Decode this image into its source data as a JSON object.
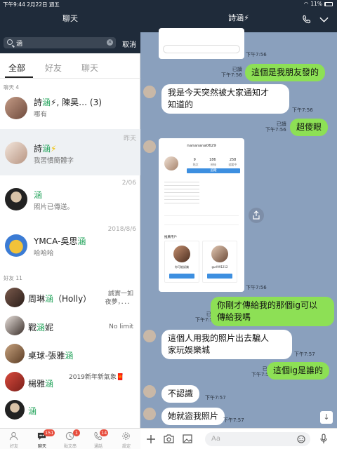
{
  "status": {
    "time_date": "下午9:44  2月22日 週五",
    "battery": "11%",
    "battery_level": 0.11
  },
  "left": {
    "title": "聊天",
    "search": {
      "value": "涵",
      "cancel": "取消"
    },
    "tabs": [
      "全部",
      "好友",
      "聊天"
    ],
    "section_chats": "聊天 4",
    "section_friends": "好友 11",
    "chats": [
      {
        "pre": "詩",
        "hl": "涵",
        "post": "⚡, 陳昊…  (3)",
        "sub": "哪有",
        "date": ""
      },
      {
        "pre": "詩",
        "hl": "涵",
        "post": "⚡",
        "sub": "我習慣簡體字",
        "date": "昨天"
      },
      {
        "pre": "",
        "hl": "涵",
        "post": "",
        "sub": "照片已傳送。",
        "date": "2/06"
      },
      {
        "pre": "YMCA-吳思",
        "hl": "涵",
        "post": "",
        "sub": "哈哈哈",
        "date": "2018/8/6"
      }
    ],
    "friends": [
      {
        "pre": "周琳",
        "hl": "涵",
        "post": "（Holly）",
        "side": "誠實一如\n夜夢，．．．"
      },
      {
        "pre": "戰",
        "hl": "涵",
        "post": "妮",
        "side": "No limit"
      },
      {
        "pre": "桌球-張雅",
        "hl": "涵",
        "post": "",
        "side": ""
      },
      {
        "pre": "楊雅",
        "hl": "涵",
        "post": "",
        "side": "2019新年新氣象🧧"
      },
      {
        "pre": "",
        "hl": "涵",
        "post": "",
        "side": ""
      }
    ],
    "nav": [
      {
        "label": "好友",
        "icon": "person-icon",
        "badge": ""
      },
      {
        "label": "聊天",
        "icon": "chat-icon",
        "badge": "151"
      },
      {
        "label": "貼文串",
        "icon": "clock-icon",
        "badge": "1"
      },
      {
        "label": "通話",
        "icon": "phone-icon",
        "badge": "14"
      },
      {
        "label": "設定",
        "icon": "gear-icon",
        "badge": ""
      }
    ]
  },
  "right": {
    "title": "詩涵⚡",
    "placeholder": "Aa",
    "messages": {
      "m1": "這個是我朋友發的",
      "m1_meta": "已讀\n下午7:56",
      "m2": "我是今天突然被大家通知才\n知道的",
      "m2_time": "下午7:56",
      "m3": "超傻眼",
      "m3_meta": "已讀\n下午7:56",
      "shot_time": "下午7:56",
      "top_time": "下午7:56",
      "m4": "你剛才傳給我的那個ig可以\n傳給我嗎",
      "m4_meta": "已讀\n下午7:57",
      "m5": "這個人用我的照片出去騙人\n家玩娛樂城",
      "m5_time": "下午7:57",
      "m6": "這個ig是誰的",
      "m6_meta": "已讀\n下午7:57",
      "m7": "不認識",
      "m7_time": "下午7:57",
      "m8": "她就盜我照片",
      "m8_time": "下午7:57"
    },
    "profile_shot": {
      "username": "nananana0629",
      "stats": [
        "9",
        "186",
        "258"
      ],
      "stat_labels": [
        "貼文",
        "粉絲",
        "追蹤中"
      ],
      "follow": "追蹤",
      "suggest": "推薦用戶",
      "s1": "你可能認識",
      "s2": "gurl991212"
    }
  }
}
